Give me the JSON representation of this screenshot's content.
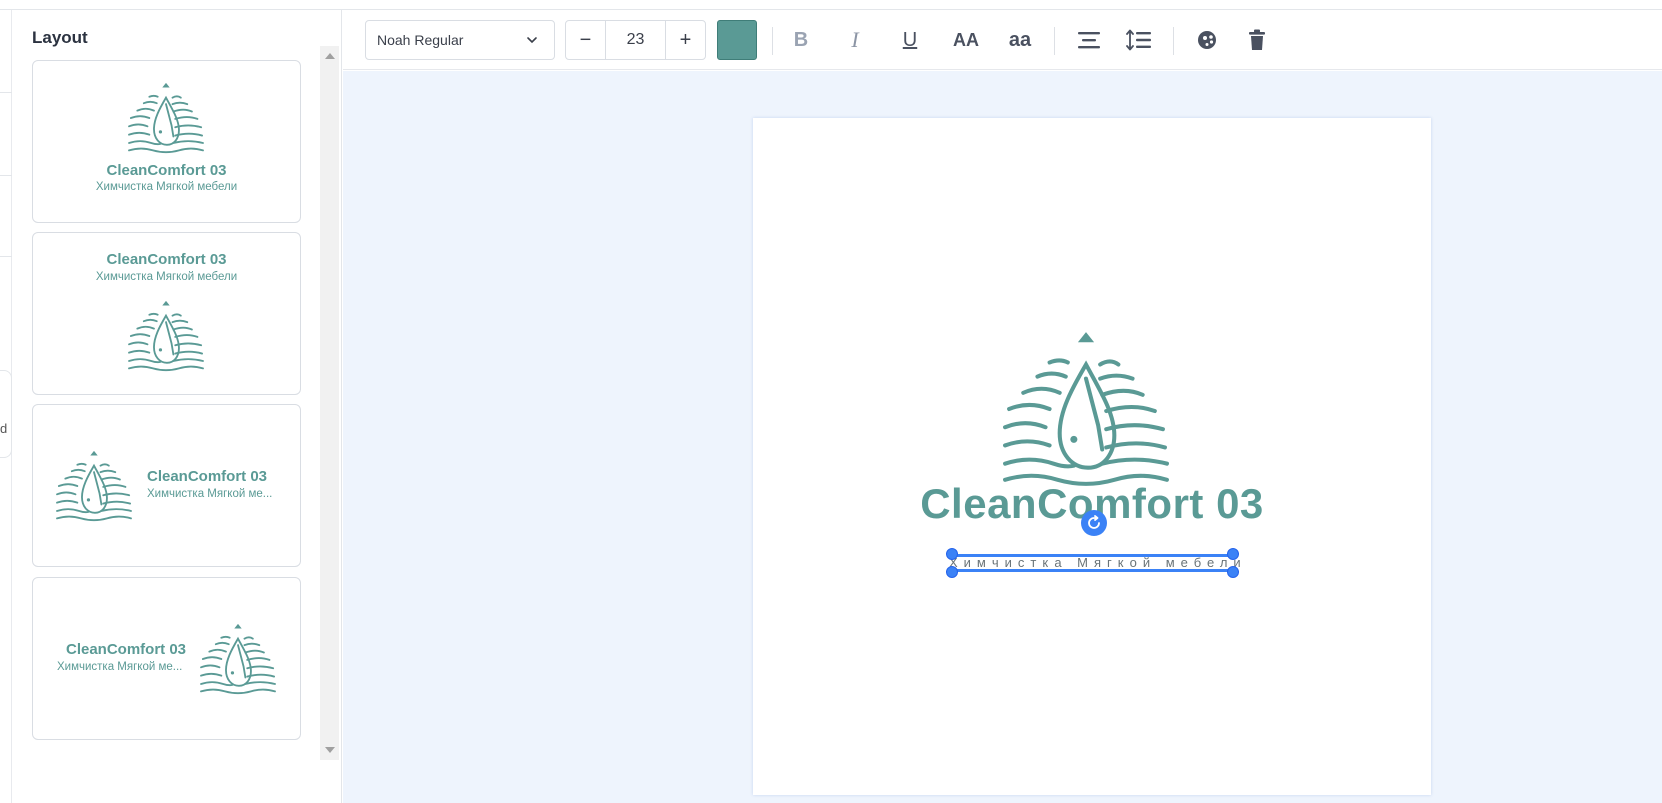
{
  "layout_panel": {
    "title": "Layout",
    "cards": [
      {
        "variant": "logo-top",
        "name": "CleanComfort 03",
        "tagline": "Химчистка Мягкой мебели"
      },
      {
        "variant": "logo-bottom",
        "name": "CleanComfort 03",
        "tagline": "Химчистка Мягкой мебели"
      },
      {
        "variant": "logo-left",
        "name": "CleanComfort 03",
        "tagline": "Химчистка Мягкой ме..."
      },
      {
        "variant": "logo-right",
        "name": "CleanComfort 03",
        "tagline": "Химчистка Мягкой ме..."
      }
    ]
  },
  "left_strip": {
    "letter": "d"
  },
  "toolbar": {
    "font_family": "Noah Regular",
    "font_size": "23",
    "decrease_label": "−",
    "increase_label": "+",
    "text_color": "#5a9a95",
    "bold_label": "B",
    "italic_label": "I",
    "underline_label": "U",
    "uppercase_label": "AA",
    "lowercase_label": "aa"
  },
  "canvas": {
    "brand_name": "CleanComfort 03",
    "tagline": "Химчистка Мягкой мебели",
    "brand_color": "#5a9a95",
    "selection_color": "#3b82f6",
    "background": "#eef4fd"
  }
}
